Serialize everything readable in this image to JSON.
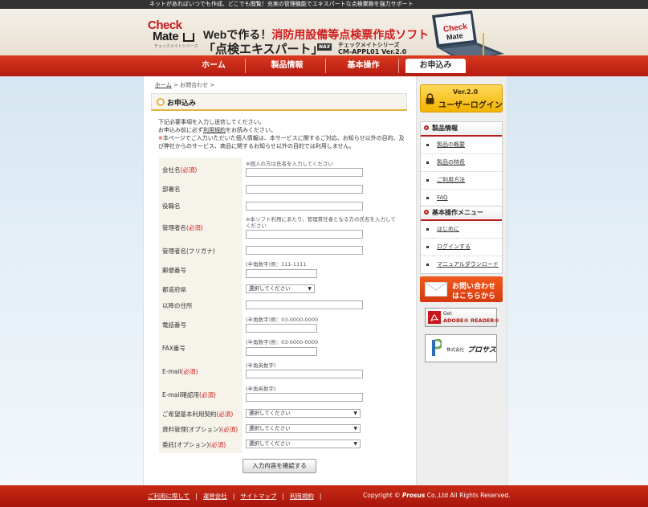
{
  "top_bar": {
    "tagline": "ネットがあればいつでも作成、どこでも閲覧！充実の管理機能でエキスパートな点検業務を強力サポート"
  },
  "header": {
    "logo_check": "Check",
    "logo_mate": "Mate",
    "logo_sub": "チェックメイトシリーズ",
    "headline_prefix": "Webで作る！",
    "headline_highlight": "消防用設備等点検票作成ソフト",
    "product_name": "「点検エキスパート」",
    "badge": "NAX",
    "series": "チェックメイトシリーズ",
    "version": "CM-APPL01 Ver.2.0"
  },
  "nav": {
    "items": [
      "ホーム",
      "製品情報",
      "基本操作",
      "お申込み"
    ],
    "active": "お申込み"
  },
  "breadcrumb": {
    "home": "ホーム",
    "separator": ">",
    "current": "お問合わせ",
    "trailing": ">"
  },
  "section": {
    "title": "お申込み"
  },
  "intro": {
    "line1": "下記必要事項を入力し送信してください。",
    "line2_prefix": "お申込み前に必ず",
    "line2_link": "利用規約",
    "line2_suffix": "をお読みください。",
    "note_mark": "※",
    "note_text": "本ページでご入力いただいた個人情報は、本サービスに関するご対応、お知らせ以外の目的、及び弊社からのサービス、商品に関するお知らせ以外の目的では利用しません。"
  },
  "form": {
    "required_mark": "(必須)",
    "fields": {
      "company": {
        "label": "会社名",
        "note": "※個人の方は氏名を入力してください"
      },
      "department": {
        "label": "部署名"
      },
      "position": {
        "label": "役職名"
      },
      "manager": {
        "label": "管理者名",
        "note": "※本ソフト利用にあたり、管理責任者となる方の氏名を入力してください"
      },
      "manager_kana": {
        "label": "管理者名(フリガナ)"
      },
      "postal": {
        "label": "郵便番号",
        "note": "(半角数字)例：111-1111"
      },
      "prefecture": {
        "label": "都道府県",
        "selected": "選択してください"
      },
      "address": {
        "label": "以降の住所"
      },
      "phone": {
        "label": "電話番号",
        "note": "(半角数字)例：03-0000-0000"
      },
      "fax": {
        "label": "FAX番号",
        "note": "(半角数字)例：03-0000-0000"
      },
      "email": {
        "label": "E-mail",
        "note": "(半角英数字)"
      },
      "email_confirm": {
        "label": "E-mail確認用",
        "note": "(半角英数字)"
      },
      "basic_contract": {
        "label": "ご希望基本利用契約",
        "selected": "選択してください"
      },
      "doc_management": {
        "label": "資料管理(オプション)",
        "selected": "選択してください"
      },
      "outsourcing": {
        "label": "委託(オプション)",
        "selected": "選択してください"
      }
    },
    "submit_label": "入力内容を確認する"
  },
  "sidebar": {
    "login": {
      "version": "Ver.2.0",
      "label": "ユーザーログイン"
    },
    "product_info": {
      "title": "製品情報",
      "items": [
        "製品の概要",
        "製品の特長",
        "ご利用方法",
        "FAQ"
      ]
    },
    "basic_ops": {
      "title": "基本操作メニュー",
      "items": [
        "はじめに",
        "ログインする",
        "マニュアルダウンロード"
      ]
    },
    "contact": {
      "line1": "お問い合わせ",
      "line2": "はこちらから"
    },
    "adobe": {
      "get": "Get",
      "reader": "ADOBE® READER®"
    },
    "prosus": {
      "company_prefix": "株式会社",
      "company_name": "プロサス"
    }
  },
  "footer": {
    "links": [
      "ご利用に際して",
      "運営会社",
      "サイトマップ",
      "利用規約"
    ],
    "link_separator": "|",
    "copyright_prefix": "Copyright ©",
    "copyright_brand": "Prosus",
    "copyright_suffix": "Co.,Ltd All Rights Reserved."
  },
  "colors": {
    "brand_red": "#c8161d",
    "nav_red": "#d93a1f",
    "accent_gold": "#e3b23c",
    "login_yellow": "#f2b400",
    "contact_orange": "#ef5a1c"
  }
}
